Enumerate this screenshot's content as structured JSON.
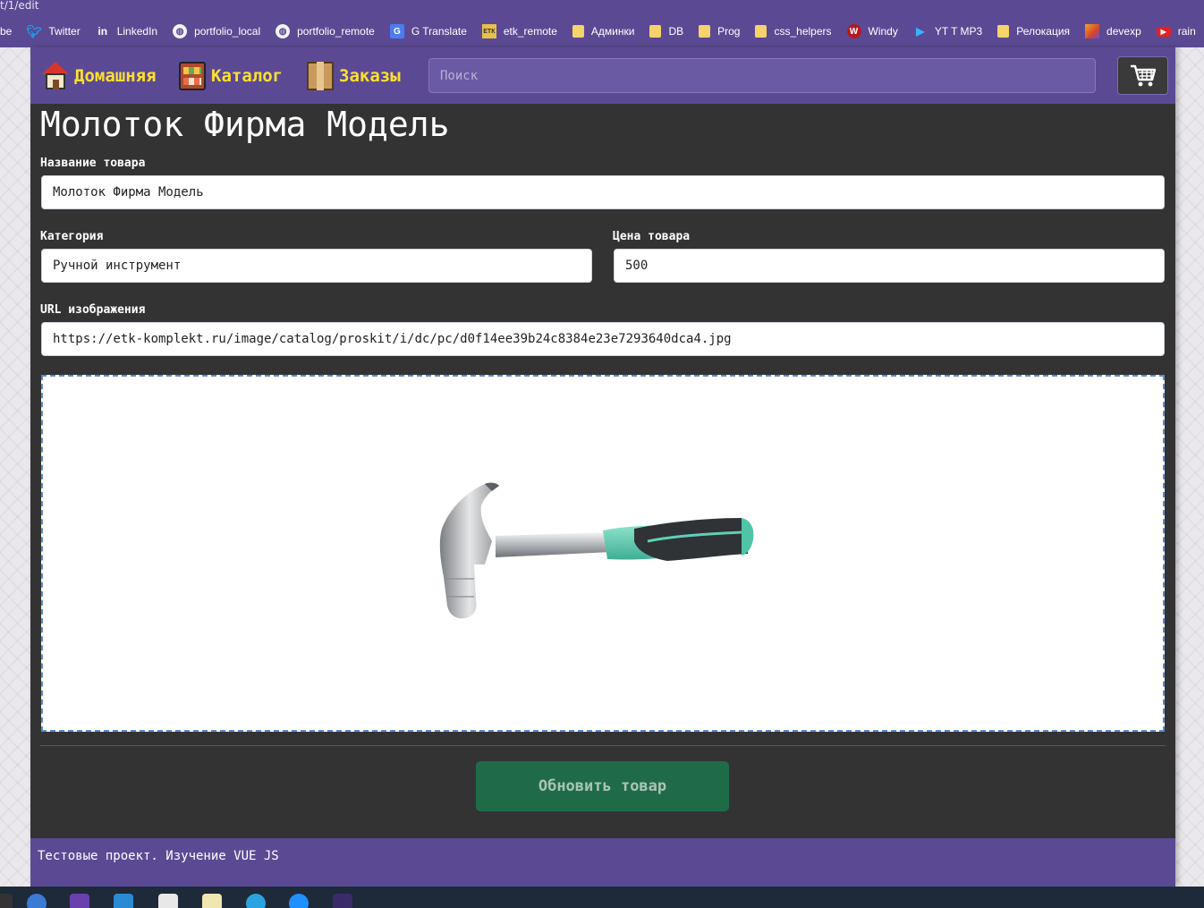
{
  "browser": {
    "url_fragment": "t/1/edit",
    "bookmarks": [
      {
        "label": "be",
        "icon": "folder-icon"
      },
      {
        "label": "Twitter",
        "icon": "twitter-icon"
      },
      {
        "label": "LinkedIn",
        "icon": "linkedin-icon"
      },
      {
        "label": "portfolio_local",
        "icon": "globe-icon"
      },
      {
        "label": "portfolio_remote",
        "icon": "globe-icon"
      },
      {
        "label": "G Translate",
        "icon": "translate-icon"
      },
      {
        "label": "etk_remote",
        "icon": "etk-icon"
      },
      {
        "label": "Админки",
        "icon": "folder-icon"
      },
      {
        "label": "DB",
        "icon": "folder-icon"
      },
      {
        "label": "Prog",
        "icon": "folder-icon"
      },
      {
        "label": "css_helpers",
        "icon": "folder-icon"
      },
      {
        "label": "Windy",
        "icon": "windy-icon"
      },
      {
        "label": "YT T MP3",
        "icon": "play-icon"
      },
      {
        "label": "Релокация",
        "icon": "folder-icon"
      },
      {
        "label": "devexp",
        "icon": "devexp-icon"
      },
      {
        "label": "rain",
        "icon": "youtube-icon"
      }
    ]
  },
  "nav": {
    "home": "Домашняя",
    "catalog": "Каталог",
    "orders": "Заказы",
    "search_placeholder": "Поиск",
    "cart_icon": "cart-icon"
  },
  "page": {
    "title": "Молоток Фирма Модель"
  },
  "form": {
    "name_label": "Название товара",
    "name_value": "Молоток Фирма Модель",
    "category_label": "Категория",
    "category_value": "Ручной инструмент",
    "price_label": "Цена товара",
    "price_value": "500",
    "image_url_label": "URL изображения",
    "image_url_value": "https://etk-komplekt.ru/image/catalog/proskit/i/dc/pc/d0f14ee39b24c8384e23e7293640dca4.jpg",
    "submit_label": "Обновить товар"
  },
  "footer": {
    "text": "Тестовые проект. Изучение VUE JS"
  },
  "colors": {
    "brand_purple": "#5b4a93",
    "nav_yellow": "#ffe02d",
    "content_bg": "#333333",
    "submit_green": "#1f6b48",
    "hammer_grip": "#5cc7ad"
  }
}
